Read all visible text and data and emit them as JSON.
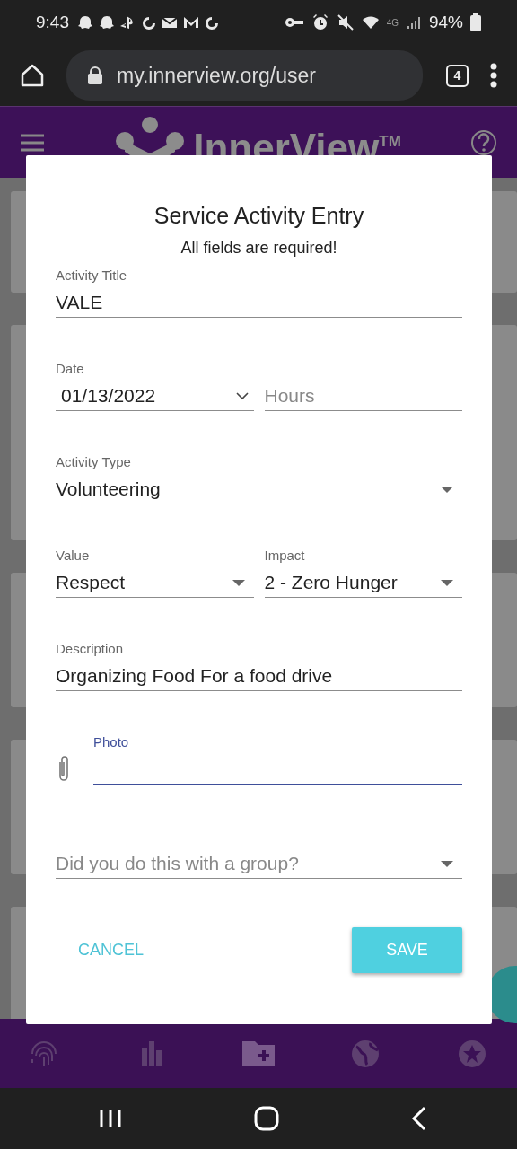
{
  "status_bar": {
    "time": "9:43",
    "network": "4G",
    "battery": "94%"
  },
  "browser": {
    "url": "my.innerview.org/user",
    "tab_count": "4"
  },
  "app_bar": {
    "logo": "InnerView",
    "trademark": "TM"
  },
  "dialog": {
    "title": "Service Activity Entry",
    "subtitle": "All fields are required!",
    "rows": [
      [
        {
          "kind": "text",
          "label": "Activity Title",
          "value": "VALE",
          "focused": false
        }
      ],
      [
        {
          "kind": "date",
          "label": "Date",
          "value": "01/13/2022",
          "focused": false
        },
        {
          "kind": "text",
          "placeholder": "Hours",
          "focused": false
        }
      ],
      [
        {
          "kind": "select",
          "label": "Activity Type",
          "value": "Volunteering",
          "focused": false
        }
      ],
      [
        {
          "kind": "select",
          "label": "Value",
          "value": "Respect",
          "focused": false
        },
        {
          "kind": "select",
          "label": "Impact",
          "value": "2 - Zero Hunger",
          "focused": false
        }
      ],
      [
        {
          "kind": "text",
          "label": "Description",
          "value": "Organizing Food For a food drive",
          "focused": false
        }
      ],
      [
        {
          "kind": "file",
          "label": "Photo",
          "focused": true
        }
      ],
      [
        {
          "kind": "select",
          "placeholder": "Did you do this with a group?",
          "focused": false
        }
      ]
    ],
    "actions": [
      {
        "label": "CANCEL",
        "kind": "flat"
      },
      {
        "label": "SAVE",
        "kind": "raised"
      }
    ]
  },
  "bottom_nav": {
    "items": [
      {
        "selected": false
      },
      {
        "selected": false
      },
      {
        "selected": true
      },
      {
        "selected": false
      },
      {
        "selected": false
      }
    ]
  }
}
